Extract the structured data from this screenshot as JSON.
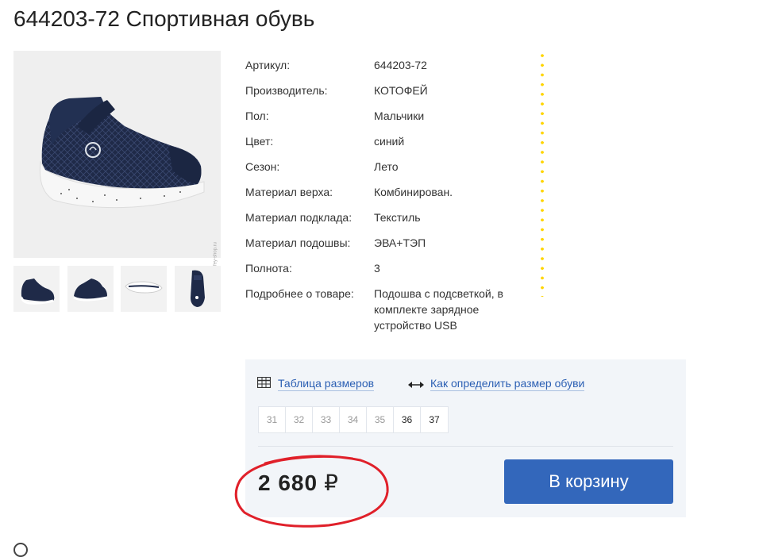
{
  "product": {
    "title": "644203-72 Спортивная обувь"
  },
  "specs": [
    {
      "label": "Артикул:",
      "value": "644203-72"
    },
    {
      "label": "Производитель:",
      "value": "КОТОФЕЙ"
    },
    {
      "label": "Пол:",
      "value": "Мальчики"
    },
    {
      "label": "Цвет:",
      "value": "синий"
    },
    {
      "label": "Сезон:",
      "value": "Лето"
    },
    {
      "label": "Материал верха:",
      "value": "Комбинирован."
    },
    {
      "label": "Материал подклада:",
      "value": "Текстиль"
    },
    {
      "label": "Материал подошвы:",
      "value": "ЭВА+ТЭП"
    },
    {
      "label": "Полнота:",
      "value": "3"
    },
    {
      "label": "Подробнее о товаре:",
      "value": "Подошва с подсветкой, в комплекте зарядное устройство USB"
    }
  ],
  "buy": {
    "size_table_link": "Таблица размеров",
    "how_to_size_link": "Как определить размер обуви",
    "sizes": [
      {
        "label": "31",
        "available": false
      },
      {
        "label": "32",
        "available": false
      },
      {
        "label": "33",
        "available": false
      },
      {
        "label": "34",
        "available": false
      },
      {
        "label": "35",
        "available": false
      },
      {
        "label": "36",
        "available": true
      },
      {
        "label": "37",
        "available": true
      }
    ],
    "price": "2 680",
    "currency": "₽",
    "cart_button": "В корзину"
  },
  "colors": {
    "accent": "#3367bb",
    "link": "#2b5fb3",
    "dots": "#ffd500",
    "annotation": "#e0202a"
  }
}
